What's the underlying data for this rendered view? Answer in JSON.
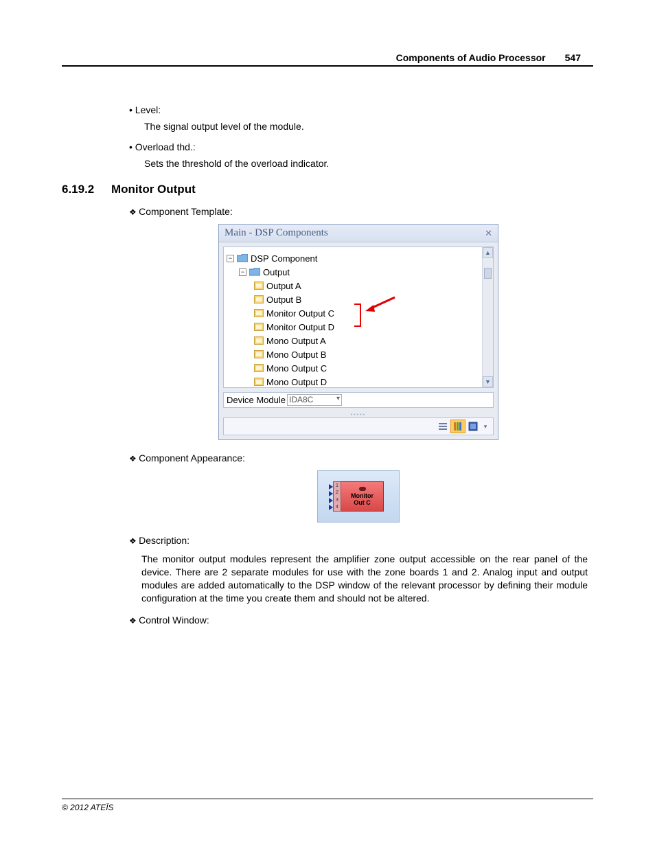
{
  "header": {
    "title": "Components of Audio Processor",
    "page": "547"
  },
  "bullets": [
    {
      "label": "Level:",
      "desc": "The signal output level of the module."
    },
    {
      "label": "Overload thd.:",
      "desc": "Sets the threshold of the overload indicator."
    }
  ],
  "section": {
    "num": "6.19.2",
    "title": "Monitor Output"
  },
  "diamonds": {
    "template": "Component Template:",
    "appearance": "Component Appearance:",
    "description": "Description:",
    "control": "Control Window:"
  },
  "panel": {
    "title": "Main - DSP Components",
    "root": "DSP Component",
    "group": "Output",
    "items": [
      "Output A",
      "Output B",
      "Monitor Output C",
      "Monitor Output D",
      "Mono Output A",
      "Mono Output B",
      "Mono Output C",
      "Mono Output D"
    ],
    "device_label": "Device Module",
    "device_value": "IDA8C"
  },
  "appearance": {
    "line1": "Monitor",
    "line2": "Out C",
    "ports": [
      "1",
      "2",
      "3",
      "4"
    ]
  },
  "description_text": "The monitor output modules represent the amplifier zone output accessible on the rear panel of the device. There are 2 separate modules for use with the zone boards 1 and 2. Analog input and output modules are added automatically to the DSP window of the relevant processor by defining their module configuration at the time you create them and should not be altered.",
  "footer": "© 2012 ATEÏS"
}
